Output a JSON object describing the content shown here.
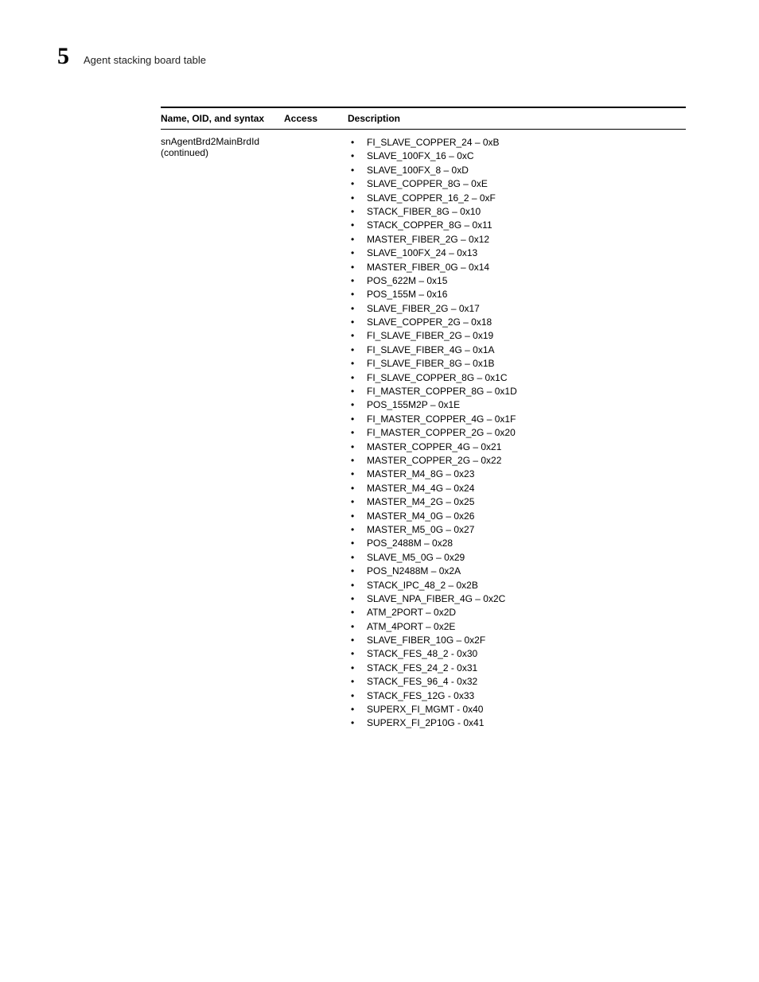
{
  "chapter": {
    "number": "5",
    "title": "Agent stacking board table"
  },
  "table": {
    "headers": {
      "name": "Name, OID, and syntax",
      "access": "Access",
      "description": "Description"
    },
    "row": {
      "name_line1": "snAgentBrd2MainBrdId",
      "name_line2": "(continued)",
      "access": "",
      "items": [
        "FI_SLAVE_COPPER_24 – 0xB",
        "SLAVE_100FX_16 – 0xC",
        "SLAVE_100FX_8 – 0xD",
        "SLAVE_COPPER_8G – 0xE",
        "SLAVE_COPPER_16_2 – 0xF",
        "STACK_FIBER_8G – 0x10",
        "STACK_COPPER_8G – 0x11",
        "MASTER_FIBER_2G – 0x12",
        "SLAVE_100FX_24 – 0x13",
        "MASTER_FIBER_0G – 0x14",
        "POS_622M – 0x15",
        "POS_155M – 0x16",
        "SLAVE_FIBER_2G – 0x17",
        "SLAVE_COPPER_2G – 0x18",
        "FI_SLAVE_FIBER_2G – 0x19",
        "FI_SLAVE_FIBER_4G – 0x1A",
        "FI_SLAVE_FIBER_8G – 0x1B",
        "FI_SLAVE_COPPER_8G – 0x1C",
        "FI_MASTER_COPPER_8G – 0x1D",
        "POS_155M2P – 0x1E",
        "FI_MASTER_COPPER_4G – 0x1F",
        "FI_MASTER_COPPER_2G – 0x20",
        "MASTER_COPPER_4G – 0x21",
        "MASTER_COPPER_2G – 0x22",
        "MASTER_M4_8G – 0x23",
        "MASTER_M4_4G – 0x24",
        "MASTER_M4_2G – 0x25",
        "MASTER_M4_0G – 0x26",
        "MASTER_M5_0G – 0x27",
        "POS_2488M – 0x28",
        "SLAVE_M5_0G – 0x29",
        "POS_N2488M – 0x2A",
        "STACK_IPC_48_2 – 0x2B",
        "SLAVE_NPA_FIBER_4G – 0x2C",
        "ATM_2PORT – 0x2D",
        "ATM_4PORT – 0x2E",
        "SLAVE_FIBER_10G – 0x2F",
        "STACK_FES_48_2 - 0x30",
        "STACK_FES_24_2 - 0x31",
        "STACK_FES_96_4 - 0x32",
        "STACK_FES_12G - 0x33",
        "SUPERX_FI_MGMT - 0x40",
        "SUPERX_FI_2P10G - 0x41"
      ]
    }
  }
}
